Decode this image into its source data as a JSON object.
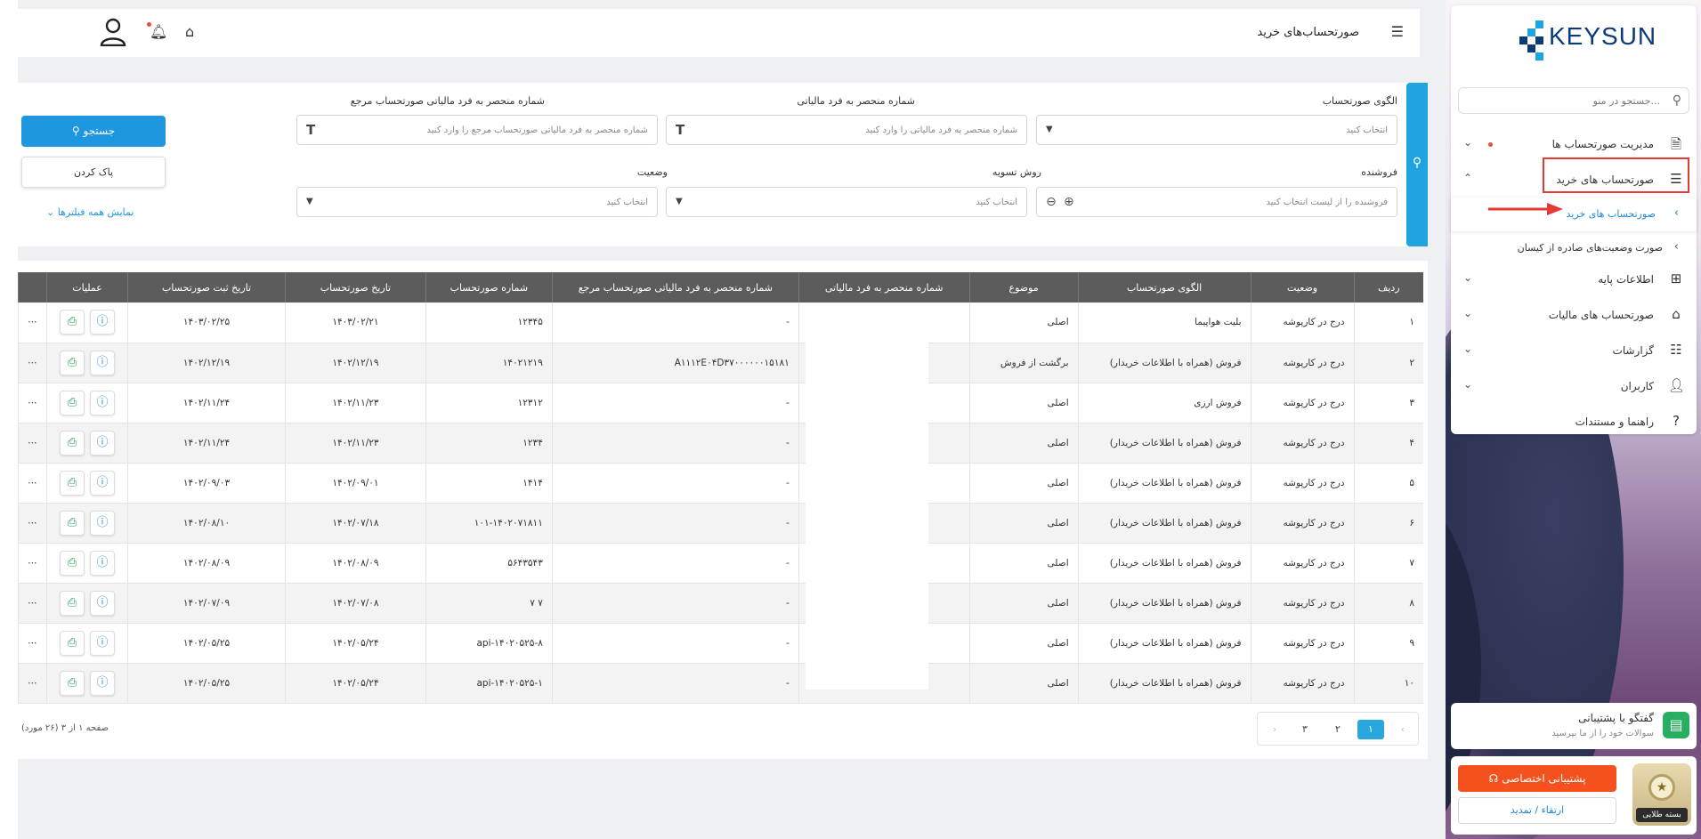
{
  "brand": {
    "logo_text": "KEYSUN",
    "accent": "#1ea5e0"
  },
  "sidebar": {
    "search_placeholder": "جستجو در منو...",
    "items": [
      {
        "label": "مدیریت صورتحساب ها",
        "icon": "invoice-icon"
      },
      {
        "label": "صورتحساب های خرید",
        "icon": "list-icon"
      },
      {
        "label": "صورتحساب های خرید",
        "icon": "chevron-left-icon"
      },
      {
        "label": "صورت وضعیت‌های صادره از کیسان",
        "icon": "chevron-left-icon"
      },
      {
        "label": "اطلاعات پایه",
        "icon": "grid-icon"
      },
      {
        "label": "صورتحساب های مالیات",
        "icon": "home-icon"
      },
      {
        "label": "گزارشات",
        "icon": "search-list-icon"
      },
      {
        "label": "کاربران",
        "icon": "user-icon"
      },
      {
        "label": "راهنما و مستندات",
        "icon": "help-icon"
      }
    ],
    "support": {
      "title": "گفتگو با پشتیبانی",
      "subtitle": "سوالات خود را از ما بپرسید"
    },
    "plan": {
      "private_support": "پشتیبانی اختصاصی",
      "upgrade": "ارتقاء / تمدید",
      "badge": "بسته طلایی"
    }
  },
  "header": {
    "title": "صورتحساب‌های خرید"
  },
  "filters": {
    "pattern_label": "الگوی صورتحساب",
    "pattern_placeholder": "انتخاب کنید",
    "taxid_label": "شماره منحصر به فرد مالیاتی",
    "taxid_placeholder": "شماره منحصر به فرد مالیاتی را وارد کنید",
    "ref_label": "شماره منحصر به فرد مالیاتی صورتحساب مرجع",
    "ref_placeholder": "شماره منحصر به فرد مالیاتی صورتحساب مرجع را وارد کنید",
    "seller_label": "فروشنده",
    "seller_placeholder": "فروشنده را از لیست انتخاب کنید",
    "settle_label": "روش تسویه",
    "settle_placeholder": "انتخاب کنید",
    "status_label": "وضعیت",
    "status_placeholder": "انتخاب کنید",
    "search_btn": "جستجو",
    "clear_btn": "پاک کردن",
    "show_all": "نمایش همه فیلترها"
  },
  "table": {
    "headers": [
      "ردیف",
      "وضعیت",
      "الگوی صورتحساب",
      "موضوع",
      "شماره منحصر به فرد مالیاتی",
      "شماره منحصر به فرد مالیاتی صورتحساب مرجع",
      "شماره صورتحساب",
      "تاریخ صورتحساب",
      "تاریخ ثبت صورتحساب",
      "عملیات"
    ],
    "rows": [
      [
        "۱",
        "درج در کارپوشه",
        "بلیت هواپیما",
        "اصلی",
        "",
        "-",
        "۱۲۳۴۵",
        "۱۴۰۳/۰۲/۲۱",
        "۱۴۰۳/۰۲/۲۵"
      ],
      [
        "۲",
        "درج در کارپوشه",
        "فروش (همراه با اطلاعات خریدار)",
        "برگشت از فروش",
        "",
        "A۱۱۱۲E۰۴D۳۷۰۰۰۰۰۰۱۵۱۸۱",
        "۱۴۰۲۱۲۱۹",
        "۱۴۰۲/۱۲/۱۹",
        "۱۴۰۲/۱۲/۱۹"
      ],
      [
        "۳",
        "درج در کارپوشه",
        "فروش ارزی",
        "اصلی",
        "",
        "-",
        "۱۲۳۱۲",
        "۱۴۰۲/۱۱/۲۳",
        "۱۴۰۲/۱۱/۲۴"
      ],
      [
        "۴",
        "درج در کارپوشه",
        "فروش (همراه با اطلاعات خریدار)",
        "اصلی",
        "",
        "-",
        "۱۲۳۴",
        "۱۴۰۲/۱۱/۲۳",
        "۱۴۰۲/۱۱/۲۴"
      ],
      [
        "۵",
        "درج در کارپوشه",
        "فروش (همراه با اطلاعات خریدار)",
        "اصلی",
        "",
        "-",
        "۱۴۱۴",
        "۱۴۰۲/۰۹/۰۱",
        "۱۴۰۲/۰۹/۰۳"
      ],
      [
        "۶",
        "درج در کارپوشه",
        "فروش (همراه با اطلاعات خریدار)",
        "اصلی",
        "",
        "-",
        "۱۰۱-۱۴۰۲۰۷۱۸۱۱",
        "۱۴۰۲/۰۷/۱۸",
        "۱۴۰۲/۰۸/۱۰"
      ],
      [
        "۷",
        "درج در کارپوشه",
        "فروش (همراه با اطلاعات خریدار)",
        "اصلی",
        "",
        "-",
        "۵۶۴۳۵۴۳",
        "۱۴۰۲/۰۸/۰۹",
        "۱۴۰۲/۰۸/۰۹"
      ],
      [
        "۸",
        "درج در کارپوشه",
        "فروش (همراه با اطلاعات خریدار)",
        "اصلی",
        "",
        "-",
        "۷ ۷",
        "۱۴۰۲/۰۷/۰۸",
        "۱۴۰۲/۰۷/۰۹"
      ],
      [
        "۹",
        "درج در کارپوشه",
        "فروش (همراه با اطلاعات خریدار)",
        "اصلی",
        "",
        "-",
        "api-۱۴۰۲۰۵۲۵-۸",
        "۱۴۰۲/۰۵/۲۴",
        "۱۴۰۲/۰۵/۲۵"
      ],
      [
        "۱۰",
        "درج در کارپوشه",
        "فروش (همراه با اطلاعات خریدار)",
        "اصلی",
        "",
        "-",
        "api-۱۴۰۲۰۵۲۵-۱",
        "۱۴۰۲/۰۵/۲۴",
        "۱۴۰۲/۰۵/۲۵"
      ]
    ]
  },
  "pagination": {
    "pages": [
      "۱",
      "۲",
      "۳"
    ],
    "active": "۱",
    "info": "صفحه ۱ از ۳ (۲۶ مورد)"
  }
}
